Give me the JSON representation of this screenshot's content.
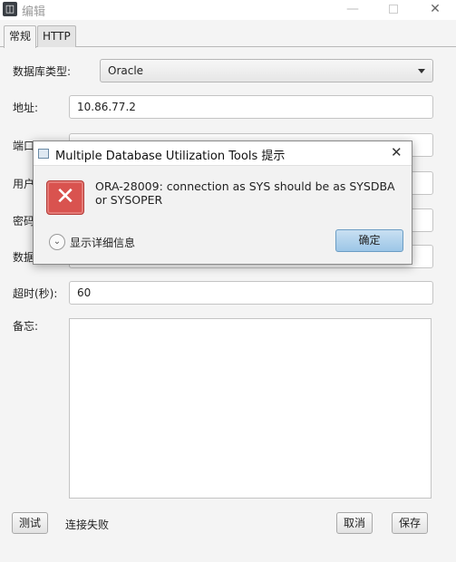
{
  "window": {
    "title": "编辑",
    "app_icon": "database-tool-icon",
    "min_icon": "minimize-icon",
    "max_icon": "maximize-icon",
    "close_icon": "close-icon"
  },
  "tabs": [
    {
      "label": "常规",
      "active": true
    },
    {
      "label": "HTTP",
      "active": false
    }
  ],
  "form": {
    "db_type": {
      "label": "数据库类型:",
      "value": "Oracle"
    },
    "address": {
      "label": "地址:",
      "value": "10.86.77.2"
    },
    "port": {
      "label": "端口",
      "value": ""
    },
    "user": {
      "label": "用户",
      "value": ""
    },
    "password": {
      "label": "密码",
      "value": ""
    },
    "database": {
      "label": "数据",
      "value": ""
    },
    "timeout": {
      "label": "超时(秒):",
      "value": "60"
    },
    "remark": {
      "label": "备忘:",
      "value": ""
    }
  },
  "footer": {
    "test_label": "测试",
    "status": "连接失败",
    "cancel_label": "取消",
    "save_label": "保存"
  },
  "dialog": {
    "title": "Multiple Database Utilization Tools 提示",
    "message": "ORA-28009: connection as SYS should be as SYSDBA or SYSOPER",
    "details_label": "显示详细信息",
    "ok_label": "确定",
    "error_icon": "error-icon",
    "accent": "#d9534f"
  }
}
